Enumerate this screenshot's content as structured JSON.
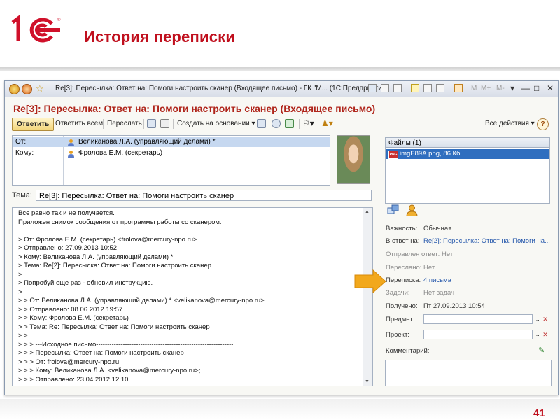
{
  "slide": {
    "title": "История переписки",
    "page_number": "41",
    "logo_text": "1C"
  },
  "window": {
    "title": "Re[3]: Пересылка: Ответ на: Помоги настроить сканер (Входящее письмо) - ГК \"М... (1С:Предприятие)",
    "mem_buttons": [
      "M",
      "M+",
      "M-"
    ],
    "controls": [
      "▾",
      "—",
      "□",
      "✕"
    ]
  },
  "document": {
    "heading": "Re[3]: Пересылка: Ответ на: Помоги настроить сканер (Входящее письмо)"
  },
  "toolbar": {
    "reply": "Ответить",
    "reply_all": "Ответить всем",
    "forward": "Переслать",
    "create_based": "Создать на основании",
    "all_actions": "Все действия",
    "help": "?"
  },
  "addresses": {
    "from_label": "От:",
    "from_value": "Великанова Л.А. (управляющий делами) *",
    "to_label": "Кому:",
    "to_value": "Фролова Е.М. (секретарь)"
  },
  "subject": {
    "label": "Тема:",
    "value": "Re[3]: Пересылка: Ответ на: Помоги настроить сканер"
  },
  "body_lines": [
    "Все равно так и не получается.",
    "Приложен снимок сообщения от программы работы со сканером.",
    "",
    "> От: Фролова Е.М. (секретарь) <frolova@mercury-npo.ru>",
    "> Отправлено: 27.09.2013 10:52",
    "> Кому: Великанова Л.А. (управляющий делами) *",
    "> Тема: Re[2]: Пересылка: Ответ на: Помоги настроить сканер",
    ">",
    "> Попробуй еще раз - обновил инструкцию.",
    ">",
    "> > От: Великанова Л.А. (управляющий делами) * <velikanova@mercury-npo.ru>",
    "> > Отправлено: 08.06.2012 19:57",
    "> > Кому: Фролова Е.М. (секретарь)",
    "> > Тема: Re: Пересылка: Ответ на: Помоги настроить сканер",
    "> >",
    "> > > ---Исходное письмо--------------------------------------------------------------",
    "> > > Пересылка: Ответ на: Помоги настроить сканер",
    "> > > От: frolova@mercury-npo.ru",
    "> > > Кому: Великанова Л.А. <velikanova@mercury-npo.ru>;",
    "> > > Отправлено: 23.04.2012 12:10"
  ],
  "files": {
    "header": "Файлы (1)",
    "items": [
      {
        "name": "imgE89A.png, 86 Кб",
        "type_badge": "PNG"
      }
    ]
  },
  "properties": {
    "importance_label": "Важность:",
    "importance_value": "Обычная",
    "in_reply_label": "В ответ на:",
    "in_reply_value": "Re[2]: Пересылка: Ответ на: Помоги на...",
    "reply_sent_label": "Отправлен ответ:",
    "reply_sent_value": "Нет",
    "forwarded_label": "Переслано:",
    "forwarded_value": "Нет",
    "correspondence_label": "Переписка:",
    "correspondence_value": "4 письма",
    "tasks_label": "Задачи:",
    "tasks_value": "Нет задач",
    "received_label": "Получено:",
    "received_value": "Пт 27.09.2013 10:54",
    "subject_label": "Предмет:",
    "subject_value": "",
    "project_label": "Проект:",
    "project_value": "",
    "comment_label": "Комментарий:",
    "comment_value": ""
  },
  "colors": {
    "title_red": "#c0101e",
    "doc_title": "#b0261c",
    "selection": "#c6d8f0",
    "file_selection": "#2f6ebf",
    "link": "#2255aa",
    "arrow": "#f2a81c"
  }
}
